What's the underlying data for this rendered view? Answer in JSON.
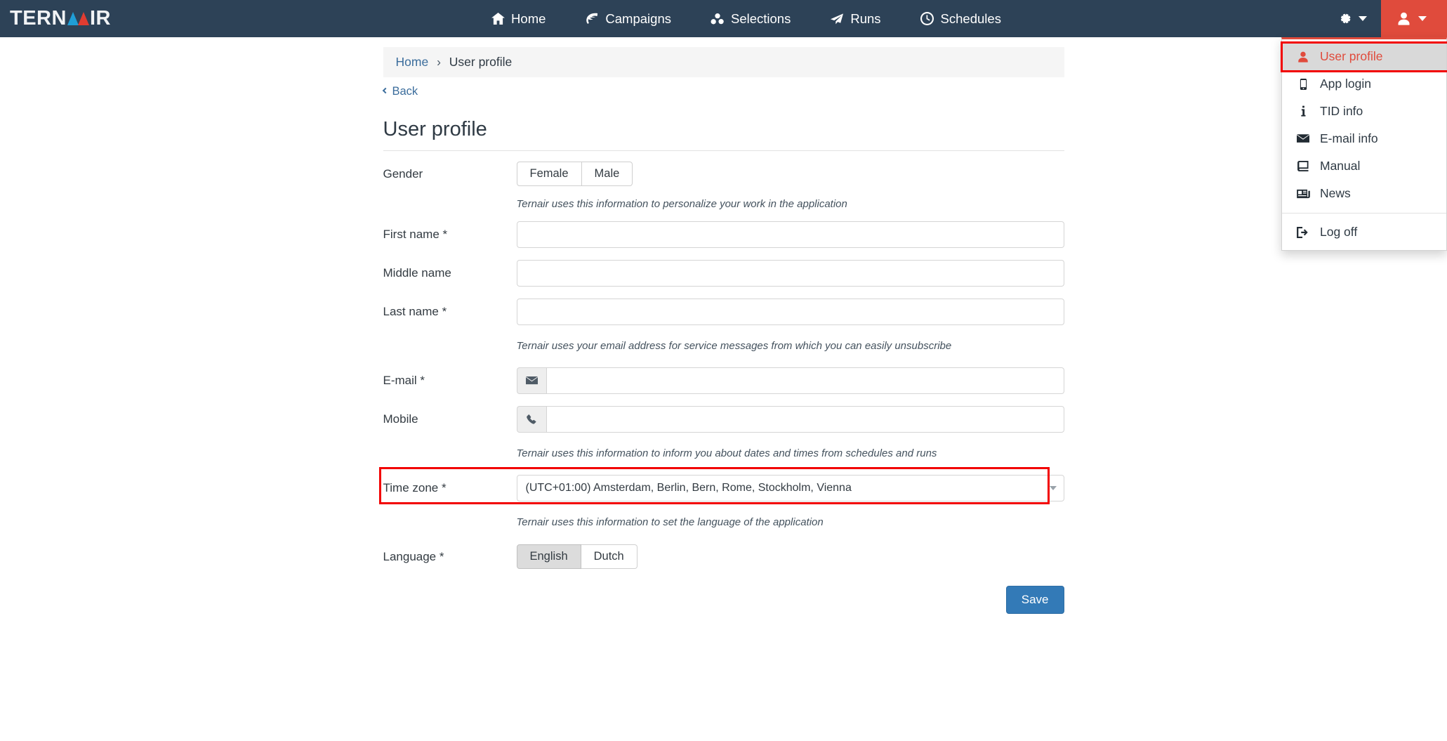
{
  "brand": {
    "text_before": "TERN",
    "text_after": "IR",
    "full": "TERNAIR",
    "triangle_blue": "#1f9ed6",
    "triangle_red": "#e03c31"
  },
  "colors": {
    "navbar_bg": "#2d4257",
    "accent_red": "#e04b3c",
    "annotation_red": "#f20000",
    "primary_blue": "#337ab7",
    "link_blue": "#3b6d9c"
  },
  "navbar": {
    "items": [
      {
        "label": "Home",
        "icon": "home-icon"
      },
      {
        "label": "Campaigns",
        "icon": "leaf-icon"
      },
      {
        "label": "Selections",
        "icon": "cubes-icon"
      },
      {
        "label": "Runs",
        "icon": "paper-plane-icon"
      },
      {
        "label": "Schedules",
        "icon": "clock-icon"
      }
    ],
    "gear": {
      "icon": "gear-icon",
      "caret": "caret-down-icon"
    },
    "user": {
      "icon": "user-icon",
      "caret": "caret-down-icon"
    }
  },
  "user_menu": {
    "items": [
      {
        "label": "User profile",
        "icon": "user-icon",
        "active": true
      },
      {
        "label": "App login",
        "icon": "mobile-icon",
        "active": false
      },
      {
        "label": "TID info",
        "icon": "info-icon",
        "active": false
      },
      {
        "label": "E-mail info",
        "icon": "envelope-icon",
        "active": false
      },
      {
        "label": "Manual",
        "icon": "book-icon",
        "active": false
      },
      {
        "label": "News",
        "icon": "newspaper-icon",
        "active": false
      }
    ],
    "logoff": {
      "label": "Log off",
      "icon": "sign-out-icon"
    }
  },
  "breadcrumb": {
    "home": "Home",
    "separator": "›",
    "current": "User profile"
  },
  "back": {
    "label": "Back"
  },
  "page": {
    "title": "User profile"
  },
  "form": {
    "gender": {
      "label": "Gender",
      "options": [
        "Female",
        "Male"
      ],
      "selected": null,
      "help": "Ternair uses this information to personalize your work in the application"
    },
    "first_name": {
      "label": "First name *",
      "value": "",
      "placeholder": ""
    },
    "middle_name": {
      "label": "Middle name",
      "value": "",
      "placeholder": ""
    },
    "last_name": {
      "label": "Last name *",
      "value": "",
      "placeholder": ""
    },
    "email_help": "Ternair uses your email address for service messages from which you can easily unsubscribe",
    "email": {
      "label": "E-mail *",
      "value": "",
      "placeholder": "",
      "icon": "envelope-icon"
    },
    "mobile": {
      "label": "Mobile",
      "value": "",
      "placeholder": "",
      "icon": "phone-icon"
    },
    "timezone_help": "Ternair uses this information to inform you about dates and times from schedules and runs",
    "timezone": {
      "label": "Time zone *",
      "value": "(UTC+01:00) Amsterdam, Berlin, Bern, Rome, Stockholm, Vienna"
    },
    "language_help": "Ternair uses this information to set the language of the application",
    "language": {
      "label": "Language *",
      "options": [
        "English",
        "Dutch"
      ],
      "selected": "English"
    },
    "save": {
      "label": "Save"
    }
  }
}
